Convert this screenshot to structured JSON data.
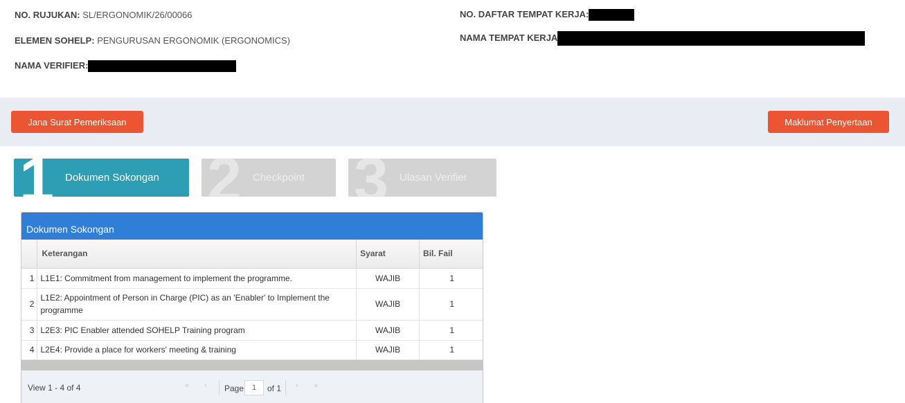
{
  "info": {
    "rujukan_label": "NO. RUJUKAN:",
    "rujukan_value": "SL/ERGONOMIK/26/00066",
    "elemen_label": "ELEMEN SOHELP:",
    "elemen_value": "PENGURUSAN ERGONOMIK (ERGONOMICS)",
    "verifier_label": "NAMA VERIFIER:",
    "daftar_label": "NO. DAFTAR TEMPAT KERJA:",
    "tempat_label": "NAMA TEMPAT KERJA"
  },
  "actions": {
    "jana_label": "Jana Surat Pemeriksaan",
    "maklumat_label": "Maklumat Penyertaan"
  },
  "steps": [
    {
      "num": "1",
      "label": "Dokumen Sokongan",
      "active": true
    },
    {
      "num": "2",
      "label": "Checkpoint",
      "active": false
    },
    {
      "num": "3",
      "label": "Ulasan Verifier",
      "active": false
    }
  ],
  "panel": {
    "title": "Dokumen Sokongan",
    "columns": {
      "keterangan": "Keterangan",
      "syarat": "Syarat",
      "bil_fail": "Bil. Fail"
    },
    "rows": [
      {
        "no": "1",
        "keterangan": "L1E1: Commitment from management to implement the programme.",
        "syarat": "WAJIB",
        "bil_fail": "1"
      },
      {
        "no": "2",
        "keterangan": "L1E2: Appointment of Person in Charge (PIC) as an 'Enabler' to Implement the programme",
        "syarat": "WAJIB",
        "bil_fail": "1"
      },
      {
        "no": "3",
        "keterangan": "L2E3: PIC Enabler attended SOHELP Training program",
        "syarat": "WAJIB",
        "bil_fail": "1"
      },
      {
        "no": "4",
        "keterangan": "L2E4: Provide a place for workers' meeting & training",
        "syarat": "WAJIB",
        "bil_fail": "1"
      }
    ],
    "pager": {
      "view_text": "View 1 - 4 of 4",
      "page_label": "Page",
      "page_value": "1",
      "of_text": "of 1"
    }
  },
  "colors": {
    "accent_orange": "#ec5534",
    "step_active": "#2e9eb5",
    "step_inactive": "#d3d3d3",
    "panel_header": "#2f7ed8",
    "action_bar": "#e9ecf3"
  },
  "icons": {
    "first": "double-chevron-left-icon",
    "prev": "chevron-left-icon",
    "next": "chevron-right-icon",
    "last": "double-chevron-right-icon"
  }
}
